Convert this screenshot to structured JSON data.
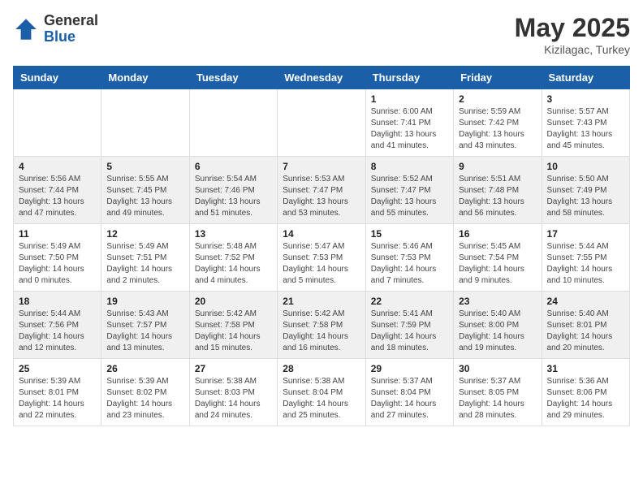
{
  "header": {
    "logo_general": "General",
    "logo_blue": "Blue",
    "month_year": "May 2025",
    "location": "Kizilagac, Turkey"
  },
  "weekdays": [
    "Sunday",
    "Monday",
    "Tuesday",
    "Wednesday",
    "Thursday",
    "Friday",
    "Saturday"
  ],
  "weeks": [
    [
      {
        "day": "",
        "info": ""
      },
      {
        "day": "",
        "info": ""
      },
      {
        "day": "",
        "info": ""
      },
      {
        "day": "",
        "info": ""
      },
      {
        "day": "1",
        "info": "Sunrise: 6:00 AM\nSunset: 7:41 PM\nDaylight: 13 hours\nand 41 minutes."
      },
      {
        "day": "2",
        "info": "Sunrise: 5:59 AM\nSunset: 7:42 PM\nDaylight: 13 hours\nand 43 minutes."
      },
      {
        "day": "3",
        "info": "Sunrise: 5:57 AM\nSunset: 7:43 PM\nDaylight: 13 hours\nand 45 minutes."
      }
    ],
    [
      {
        "day": "4",
        "info": "Sunrise: 5:56 AM\nSunset: 7:44 PM\nDaylight: 13 hours\nand 47 minutes."
      },
      {
        "day": "5",
        "info": "Sunrise: 5:55 AM\nSunset: 7:45 PM\nDaylight: 13 hours\nand 49 minutes."
      },
      {
        "day": "6",
        "info": "Sunrise: 5:54 AM\nSunset: 7:46 PM\nDaylight: 13 hours\nand 51 minutes."
      },
      {
        "day": "7",
        "info": "Sunrise: 5:53 AM\nSunset: 7:47 PM\nDaylight: 13 hours\nand 53 minutes."
      },
      {
        "day": "8",
        "info": "Sunrise: 5:52 AM\nSunset: 7:47 PM\nDaylight: 13 hours\nand 55 minutes."
      },
      {
        "day": "9",
        "info": "Sunrise: 5:51 AM\nSunset: 7:48 PM\nDaylight: 13 hours\nand 56 minutes."
      },
      {
        "day": "10",
        "info": "Sunrise: 5:50 AM\nSunset: 7:49 PM\nDaylight: 13 hours\nand 58 minutes."
      }
    ],
    [
      {
        "day": "11",
        "info": "Sunrise: 5:49 AM\nSunset: 7:50 PM\nDaylight: 14 hours\nand 0 minutes."
      },
      {
        "day": "12",
        "info": "Sunrise: 5:49 AM\nSunset: 7:51 PM\nDaylight: 14 hours\nand 2 minutes."
      },
      {
        "day": "13",
        "info": "Sunrise: 5:48 AM\nSunset: 7:52 PM\nDaylight: 14 hours\nand 4 minutes."
      },
      {
        "day": "14",
        "info": "Sunrise: 5:47 AM\nSunset: 7:53 PM\nDaylight: 14 hours\nand 5 minutes."
      },
      {
        "day": "15",
        "info": "Sunrise: 5:46 AM\nSunset: 7:53 PM\nDaylight: 14 hours\nand 7 minutes."
      },
      {
        "day": "16",
        "info": "Sunrise: 5:45 AM\nSunset: 7:54 PM\nDaylight: 14 hours\nand 9 minutes."
      },
      {
        "day": "17",
        "info": "Sunrise: 5:44 AM\nSunset: 7:55 PM\nDaylight: 14 hours\nand 10 minutes."
      }
    ],
    [
      {
        "day": "18",
        "info": "Sunrise: 5:44 AM\nSunset: 7:56 PM\nDaylight: 14 hours\nand 12 minutes."
      },
      {
        "day": "19",
        "info": "Sunrise: 5:43 AM\nSunset: 7:57 PM\nDaylight: 14 hours\nand 13 minutes."
      },
      {
        "day": "20",
        "info": "Sunrise: 5:42 AM\nSunset: 7:58 PM\nDaylight: 14 hours\nand 15 minutes."
      },
      {
        "day": "21",
        "info": "Sunrise: 5:42 AM\nSunset: 7:58 PM\nDaylight: 14 hours\nand 16 minutes."
      },
      {
        "day": "22",
        "info": "Sunrise: 5:41 AM\nSunset: 7:59 PM\nDaylight: 14 hours\nand 18 minutes."
      },
      {
        "day": "23",
        "info": "Sunrise: 5:40 AM\nSunset: 8:00 PM\nDaylight: 14 hours\nand 19 minutes."
      },
      {
        "day": "24",
        "info": "Sunrise: 5:40 AM\nSunset: 8:01 PM\nDaylight: 14 hours\nand 20 minutes."
      }
    ],
    [
      {
        "day": "25",
        "info": "Sunrise: 5:39 AM\nSunset: 8:01 PM\nDaylight: 14 hours\nand 22 minutes."
      },
      {
        "day": "26",
        "info": "Sunrise: 5:39 AM\nSunset: 8:02 PM\nDaylight: 14 hours\nand 23 minutes."
      },
      {
        "day": "27",
        "info": "Sunrise: 5:38 AM\nSunset: 8:03 PM\nDaylight: 14 hours\nand 24 minutes."
      },
      {
        "day": "28",
        "info": "Sunrise: 5:38 AM\nSunset: 8:04 PM\nDaylight: 14 hours\nand 25 minutes."
      },
      {
        "day": "29",
        "info": "Sunrise: 5:37 AM\nSunset: 8:04 PM\nDaylight: 14 hours\nand 27 minutes."
      },
      {
        "day": "30",
        "info": "Sunrise: 5:37 AM\nSunset: 8:05 PM\nDaylight: 14 hours\nand 28 minutes."
      },
      {
        "day": "31",
        "info": "Sunrise: 5:36 AM\nSunset: 8:06 PM\nDaylight: 14 hours\nand 29 minutes."
      }
    ]
  ]
}
